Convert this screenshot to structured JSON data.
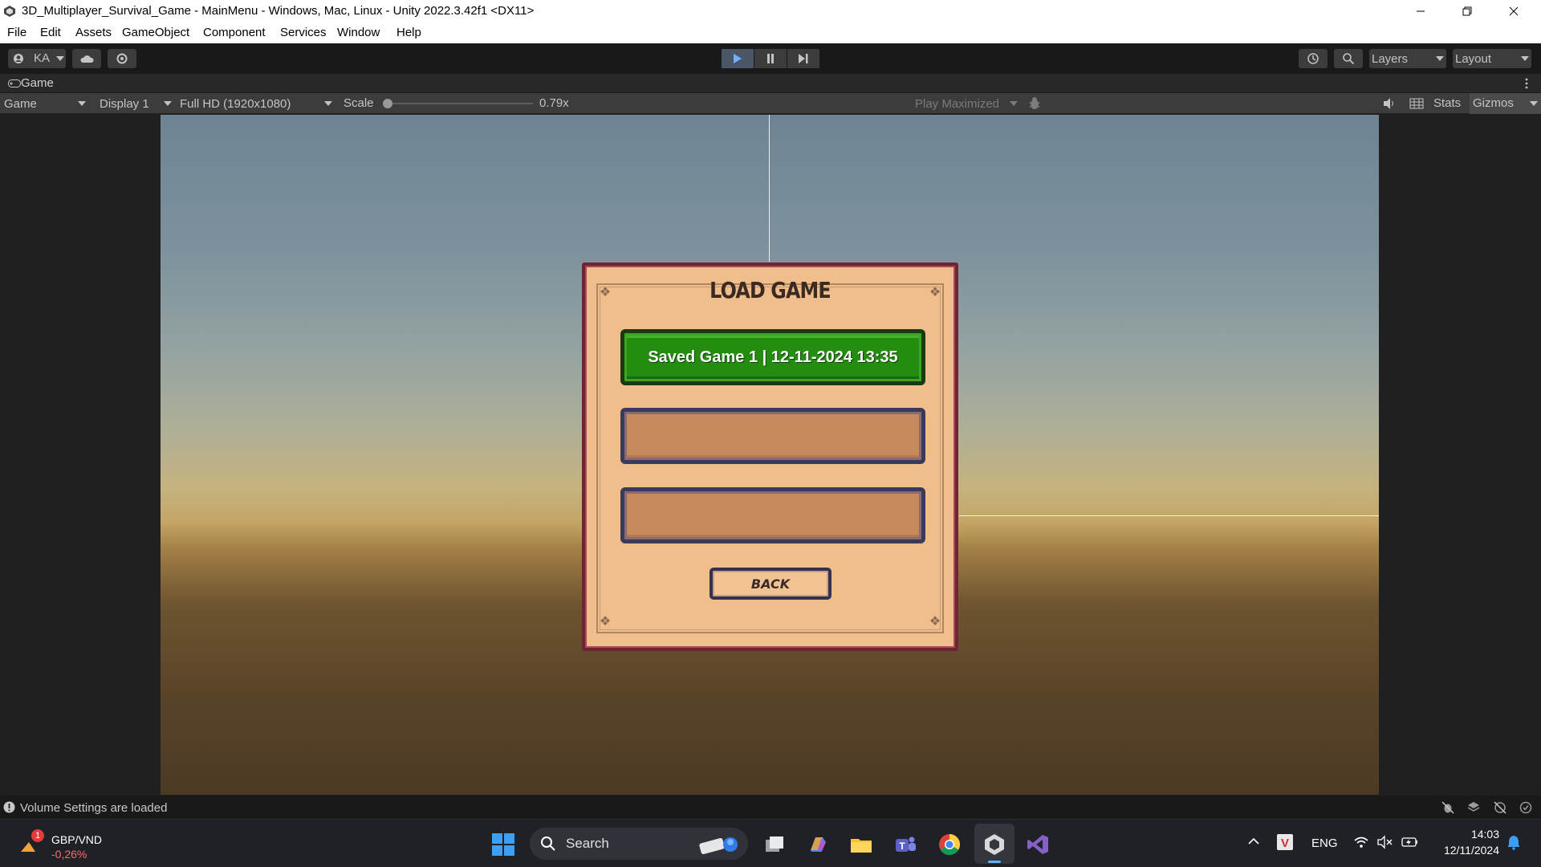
{
  "window": {
    "title": "3D_Multiplayer_Survival_Game - MainMenu - Windows, Mac, Linux - Unity 2022.3.42f1 <DX11>",
    "controls": [
      "minimize",
      "restore",
      "close"
    ]
  },
  "menu": {
    "items": [
      "File",
      "Edit",
      "Assets",
      "GameObject",
      "Component",
      "Services",
      "Window",
      "Help"
    ]
  },
  "toolbar": {
    "account": "KA",
    "layers_label": "Layers",
    "layout_label": "Layout"
  },
  "game_tab": {
    "title": "Game",
    "mode": "Game",
    "display": "Display 1",
    "resolution": "Full HD (1920x1080)",
    "scale_label": "Scale",
    "scale_value": "0.79x",
    "scale_fraction": 0.0,
    "play_mode": "Play Maximized",
    "stats_label": "Stats",
    "gizmos_label": "Gizmos"
  },
  "load_panel": {
    "title": "LOAD GAME",
    "slots": [
      {
        "label": "Saved Game 1 | 12-11-2024 13:35",
        "filled": true
      },
      {
        "label": "",
        "filled": false
      },
      {
        "label": "",
        "filled": false
      }
    ],
    "back_label": "BACK"
  },
  "status": {
    "message": "Volume Settings are loaded"
  },
  "taskbar": {
    "ticker_name": "GBP/VND",
    "ticker_change": "-0,26%",
    "ticker_badge": "1",
    "search_placeholder": "Search",
    "language": "ENG",
    "time": "14:03",
    "date": "12/11/2024",
    "colors": {
      "ticker_change": "#ff6b6b",
      "windows_logo": "#3ba0f3"
    }
  }
}
